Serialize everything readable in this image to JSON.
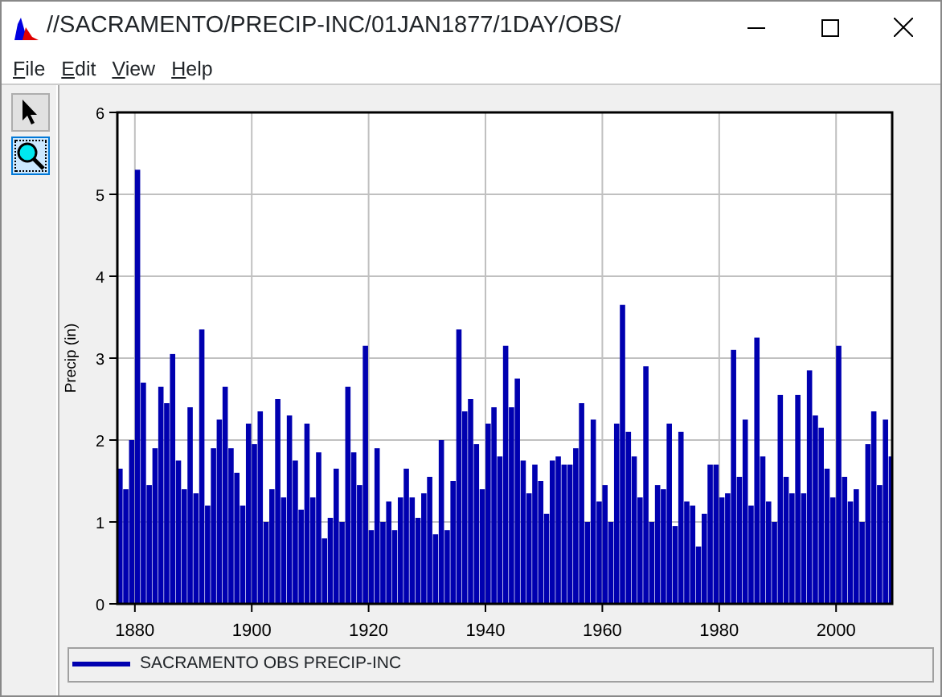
{
  "window": {
    "title": "//SACRAMENTO/PRECIP-INC/01JAN1877/1DAY/OBS/"
  },
  "menu": [
    "File",
    "Edit",
    "View",
    "Help"
  ],
  "tools": [
    {
      "kind": "pointer",
      "selected": false
    },
    {
      "kind": "zoom",
      "selected": true
    }
  ],
  "plot": {
    "chart_data": {
      "type": "bar",
      "ylabel": "Precip (in)",
      "xlim": [
        1877,
        2009.6
      ],
      "grid": true,
      "ylim": [
        0,
        6
      ],
      "xticks": [
        1880,
        1900,
        1920,
        1940,
        1960,
        1980,
        2000
      ],
      "yticks": [
        0,
        1,
        2,
        3,
        4,
        5,
        6
      ],
      "x": [
        1877,
        1878,
        1879,
        1880,
        1881,
        1882,
        1883,
        1884,
        1885,
        1886,
        1887,
        1888,
        1889,
        1890,
        1891,
        1892,
        1893,
        1894,
        1895,
        1896,
        1897,
        1898,
        1899,
        1900,
        1901,
        1902,
        1903,
        1904,
        1905,
        1906,
        1907,
        1908,
        1909,
        1910,
        1911,
        1912,
        1913,
        1914,
        1915,
        1916,
        1917,
        1918,
        1919,
        1920,
        1921,
        1922,
        1923,
        1924,
        1925,
        1926,
        1927,
        1928,
        1929,
        1930,
        1931,
        1932,
        1933,
        1934,
        1935,
        1936,
        1937,
        1938,
        1939,
        1940,
        1941,
        1942,
        1943,
        1944,
        1945,
        1946,
        1947,
        1948,
        1949,
        1950,
        1951,
        1952,
        1953,
        1954,
        1955,
        1956,
        1957,
        1958,
        1959,
        1960,
        1961,
        1962,
        1963,
        1964,
        1965,
        1966,
        1967,
        1968,
        1969,
        1970,
        1971,
        1972,
        1973,
        1974,
        1975,
        1976,
        1977,
        1978,
        1979,
        1980,
        1981,
        1982,
        1983,
        1984,
        1985,
        1986,
        1987,
        1988,
        1989,
        1990,
        1991,
        1992,
        1993,
        1994,
        1995,
        1996,
        1997,
        1998,
        1999,
        2000,
        2001,
        2002,
        2003,
        2004,
        2005,
        2006,
        2007,
        2008,
        2009
      ],
      "series": [
        {
          "name": "SACRAMENTO OBS PRECIP-INC",
          "color": "#0000b0",
          "values": [
            1.65,
            1.4,
            2.0,
            5.3,
            2.7,
            1.45,
            1.9,
            2.65,
            2.45,
            3.05,
            1.75,
            1.4,
            2.4,
            1.35,
            3.35,
            1.2,
            1.9,
            2.25,
            2.65,
            1.9,
            1.6,
            1.2,
            2.2,
            1.95,
            2.35,
            1.0,
            1.4,
            2.5,
            1.3,
            2.3,
            1.75,
            1.15,
            2.2,
            1.3,
            1.85,
            0.8,
            1.05,
            1.65,
            1.0,
            2.65,
            1.85,
            1.45,
            3.15,
            0.9,
            1.9,
            1.0,
            1.25,
            0.9,
            1.3,
            1.65,
            1.3,
            1.05,
            1.35,
            1.55,
            0.85,
            2.0,
            0.9,
            1.5,
            3.35,
            2.35,
            2.5,
            1.95,
            1.4,
            2.2,
            2.4,
            1.8,
            3.15,
            2.4,
            2.75,
            1.75,
            1.35,
            1.7,
            1.5,
            1.1,
            1.75,
            1.8,
            1.7,
            1.7,
            1.9,
            2.45,
            1.0,
            2.25,
            1.25,
            1.45,
            1.0,
            2.2,
            3.65,
            2.1,
            1.8,
            1.3,
            2.9,
            1.0,
            1.45,
            1.4,
            2.2,
            0.95,
            2.1,
            1.25,
            1.2,
            0.7,
            1.1,
            1.7,
            1.7,
            1.3,
            1.35,
            3.1,
            1.55,
            2.25,
            1.2,
            3.25,
            1.8,
            1.25,
            1.0,
            2.55,
            1.55,
            1.35,
            2.55,
            1.35,
            2.85,
            2.3,
            2.15,
            1.65,
            1.3,
            3.15,
            1.55,
            1.25,
            1.4,
            1.0,
            1.95,
            2.35,
            1.45,
            2.25,
            1.8
          ]
        }
      ]
    }
  }
}
